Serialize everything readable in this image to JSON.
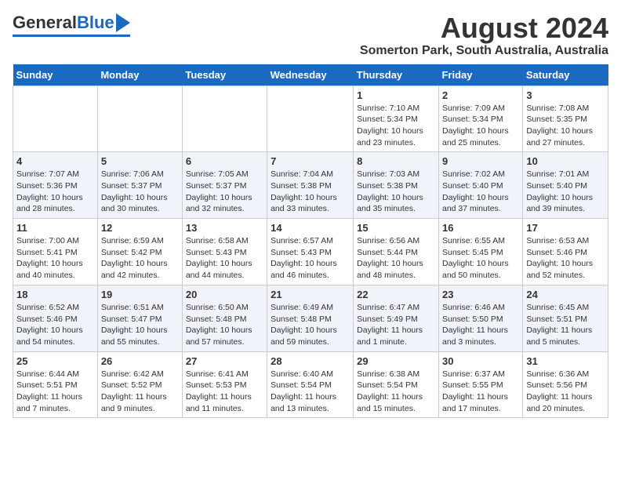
{
  "header": {
    "logo_general": "General",
    "logo_blue": "Blue",
    "month_year": "August 2024",
    "location": "Somerton Park, South Australia, Australia"
  },
  "columns": [
    "Sunday",
    "Monday",
    "Tuesday",
    "Wednesday",
    "Thursday",
    "Friday",
    "Saturday"
  ],
  "weeks": [
    [
      {
        "day": "",
        "info": ""
      },
      {
        "day": "",
        "info": ""
      },
      {
        "day": "",
        "info": ""
      },
      {
        "day": "",
        "info": ""
      },
      {
        "day": "1",
        "info": "Sunrise: 7:10 AM\nSunset: 5:34 PM\nDaylight: 10 hours\nand 23 minutes."
      },
      {
        "day": "2",
        "info": "Sunrise: 7:09 AM\nSunset: 5:34 PM\nDaylight: 10 hours\nand 25 minutes."
      },
      {
        "day": "3",
        "info": "Sunrise: 7:08 AM\nSunset: 5:35 PM\nDaylight: 10 hours\nand 27 minutes."
      }
    ],
    [
      {
        "day": "4",
        "info": "Sunrise: 7:07 AM\nSunset: 5:36 PM\nDaylight: 10 hours\nand 28 minutes."
      },
      {
        "day": "5",
        "info": "Sunrise: 7:06 AM\nSunset: 5:37 PM\nDaylight: 10 hours\nand 30 minutes."
      },
      {
        "day": "6",
        "info": "Sunrise: 7:05 AM\nSunset: 5:37 PM\nDaylight: 10 hours\nand 32 minutes."
      },
      {
        "day": "7",
        "info": "Sunrise: 7:04 AM\nSunset: 5:38 PM\nDaylight: 10 hours\nand 33 minutes."
      },
      {
        "day": "8",
        "info": "Sunrise: 7:03 AM\nSunset: 5:38 PM\nDaylight: 10 hours\nand 35 minutes."
      },
      {
        "day": "9",
        "info": "Sunrise: 7:02 AM\nSunset: 5:40 PM\nDaylight: 10 hours\nand 37 minutes."
      },
      {
        "day": "10",
        "info": "Sunrise: 7:01 AM\nSunset: 5:40 PM\nDaylight: 10 hours\nand 39 minutes."
      }
    ],
    [
      {
        "day": "11",
        "info": "Sunrise: 7:00 AM\nSunset: 5:41 PM\nDaylight: 10 hours\nand 40 minutes."
      },
      {
        "day": "12",
        "info": "Sunrise: 6:59 AM\nSunset: 5:42 PM\nDaylight: 10 hours\nand 42 minutes."
      },
      {
        "day": "13",
        "info": "Sunrise: 6:58 AM\nSunset: 5:43 PM\nDaylight: 10 hours\nand 44 minutes."
      },
      {
        "day": "14",
        "info": "Sunrise: 6:57 AM\nSunset: 5:43 PM\nDaylight: 10 hours\nand 46 minutes."
      },
      {
        "day": "15",
        "info": "Sunrise: 6:56 AM\nSunset: 5:44 PM\nDaylight: 10 hours\nand 48 minutes."
      },
      {
        "day": "16",
        "info": "Sunrise: 6:55 AM\nSunset: 5:45 PM\nDaylight: 10 hours\nand 50 minutes."
      },
      {
        "day": "17",
        "info": "Sunrise: 6:53 AM\nSunset: 5:46 PM\nDaylight: 10 hours\nand 52 minutes."
      }
    ],
    [
      {
        "day": "18",
        "info": "Sunrise: 6:52 AM\nSunset: 5:46 PM\nDaylight: 10 hours\nand 54 minutes."
      },
      {
        "day": "19",
        "info": "Sunrise: 6:51 AM\nSunset: 5:47 PM\nDaylight: 10 hours\nand 55 minutes."
      },
      {
        "day": "20",
        "info": "Sunrise: 6:50 AM\nSunset: 5:48 PM\nDaylight: 10 hours\nand 57 minutes."
      },
      {
        "day": "21",
        "info": "Sunrise: 6:49 AM\nSunset: 5:48 PM\nDaylight: 10 hours\nand 59 minutes."
      },
      {
        "day": "22",
        "info": "Sunrise: 6:47 AM\nSunset: 5:49 PM\nDaylight: 11 hours\nand 1 minute."
      },
      {
        "day": "23",
        "info": "Sunrise: 6:46 AM\nSunset: 5:50 PM\nDaylight: 11 hours\nand 3 minutes."
      },
      {
        "day": "24",
        "info": "Sunrise: 6:45 AM\nSunset: 5:51 PM\nDaylight: 11 hours\nand 5 minutes."
      }
    ],
    [
      {
        "day": "25",
        "info": "Sunrise: 6:44 AM\nSunset: 5:51 PM\nDaylight: 11 hours\nand 7 minutes."
      },
      {
        "day": "26",
        "info": "Sunrise: 6:42 AM\nSunset: 5:52 PM\nDaylight: 11 hours\nand 9 minutes."
      },
      {
        "day": "27",
        "info": "Sunrise: 6:41 AM\nSunset: 5:53 PM\nDaylight: 11 hours\nand 11 minutes."
      },
      {
        "day": "28",
        "info": "Sunrise: 6:40 AM\nSunset: 5:54 PM\nDaylight: 11 hours\nand 13 minutes."
      },
      {
        "day": "29",
        "info": "Sunrise: 6:38 AM\nSunset: 5:54 PM\nDaylight: 11 hours\nand 15 minutes."
      },
      {
        "day": "30",
        "info": "Sunrise: 6:37 AM\nSunset: 5:55 PM\nDaylight: 11 hours\nand 17 minutes."
      },
      {
        "day": "31",
        "info": "Sunrise: 6:36 AM\nSunset: 5:56 PM\nDaylight: 11 hours\nand 20 minutes."
      }
    ]
  ]
}
